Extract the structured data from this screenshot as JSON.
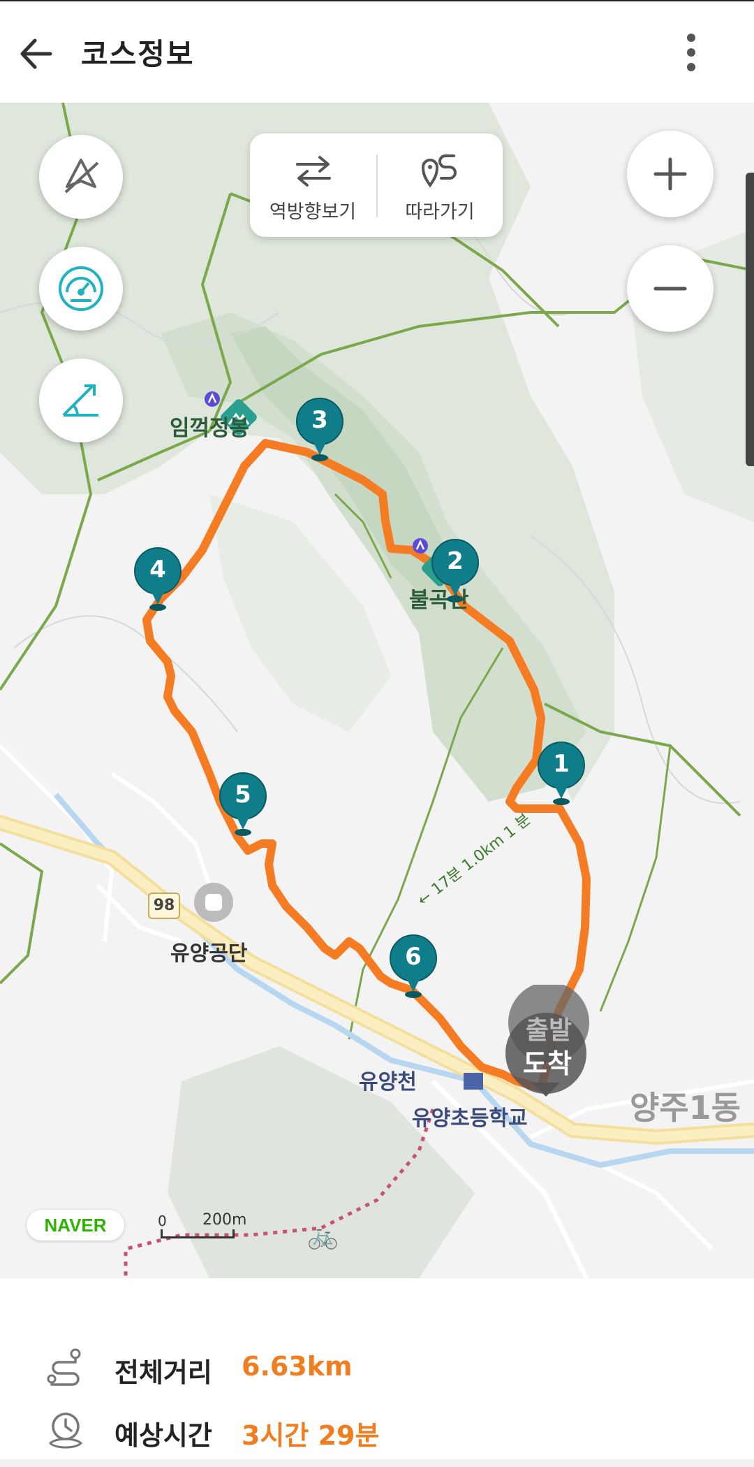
{
  "header": {
    "title": "코스정보"
  },
  "map_controls": {
    "reverse_label": "역방향보기",
    "follow_label": "따라가기"
  },
  "map_labels": {
    "peak1": "임꺽정봉",
    "peak2": "불곡산",
    "gongdan": "유양공단",
    "stream": "유양천",
    "school": "유양초등학교",
    "district": "양주1동",
    "road": "98",
    "trail_note": "← 17분 1.0km 1 분",
    "start": "출발",
    "end": "도착"
  },
  "waypoints": [
    "1",
    "2",
    "3",
    "4",
    "5",
    "6"
  ],
  "map_footer": {
    "logo": "NAVER",
    "scale_zero": "0",
    "scale_dist": "200m"
  },
  "summary": {
    "distance_label": "전체거리",
    "distance_value": "6.63km",
    "time_label": "예상시간",
    "time_value": "3시간 29분"
  },
  "colors": {
    "route": "#f57c22",
    "marker": "#0f7e8a",
    "accent": "#f07d1f"
  }
}
